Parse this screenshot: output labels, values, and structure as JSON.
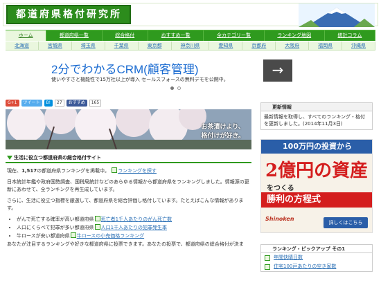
{
  "header": {
    "title": "都道府県格付研究所"
  },
  "nav": [
    "ホーム",
    "都道府県一覧",
    "総合格付",
    "おすすめ一覧",
    "全カテゴリー覧",
    "ランキング地図",
    "統計コラム"
  ],
  "pref": [
    "北海道",
    "宮城県",
    "埼玉県",
    "千葉県",
    "東京都",
    "神奈川県",
    "愛知県",
    "京都府",
    "大阪府",
    "福岡県",
    "沖縄県"
  ],
  "ad": {
    "title": "2分でわかるCRM(顧客管理)",
    "sub": "使いやすさと機能性で15万社以上が導入 セールスフォースの無料デモを公開中。",
    "arrow": "→"
  },
  "social": {
    "g": "G+1",
    "tw": "ツイート",
    "b_count": "27",
    "fb": "おすすめ",
    "fb_count": "165"
  },
  "hero": {
    "line1": "お茶漬けより、",
    "line2": "格付けが好き。"
  },
  "section": {
    "title": "生活に役立つ都道府県の総合格付サイト"
  },
  "content": {
    "p1_pre": "現在、",
    "count": "1,517",
    "p1_mid": "の都道府県ランキングを掲載中。",
    "p1_link": "ランキングを探す",
    "p2": "日本統計年鑑や政府国勢調査、国税局統計などのあらゆる情報から都道府県をランキングしました。情報源の更新にあわせて、全ランキングを再生成しています。",
    "p3": "さらに、生活に役立つ指標を厳選して、都道府県を総合評価し格付しています。たとえばこんな情報があります。",
    "items": [
      {
        "text": "がんで死亡する確率が高い都道府県",
        "link": "死亡者1千人あたりのがん死亡数"
      },
      {
        "text": "人口にくらべて犯罪が多い都道府県",
        "link": "人口1千人あたりの犯罪発生率"
      },
      {
        "text": "牛ロースが安い都道府県",
        "link": "牛ロースの小売価格ランキング"
      }
    ],
    "p4": "あなたが注目するランキングや好きな都道府県に投票できます。あなたの投票で、都道府県の総合格付が決ま"
  },
  "side": {
    "update_title": "更新情報",
    "update_text": "最新情報を取得し、すべてのランキング・格付を更新しました。(2014年11月3日)",
    "banner": {
      "top": "100万円の投資から",
      "big": "2億円の資産",
      "small": "をつくる",
      "strip": "勝利の方程式",
      "logo": "Shinoken",
      "button": "詳しくはこちら"
    },
    "rank_title": "ランキング・ピックアップ その1",
    "rank_items": [
      "年間快晴日数",
      "住宅100戸あたりの空き家数"
    ]
  }
}
